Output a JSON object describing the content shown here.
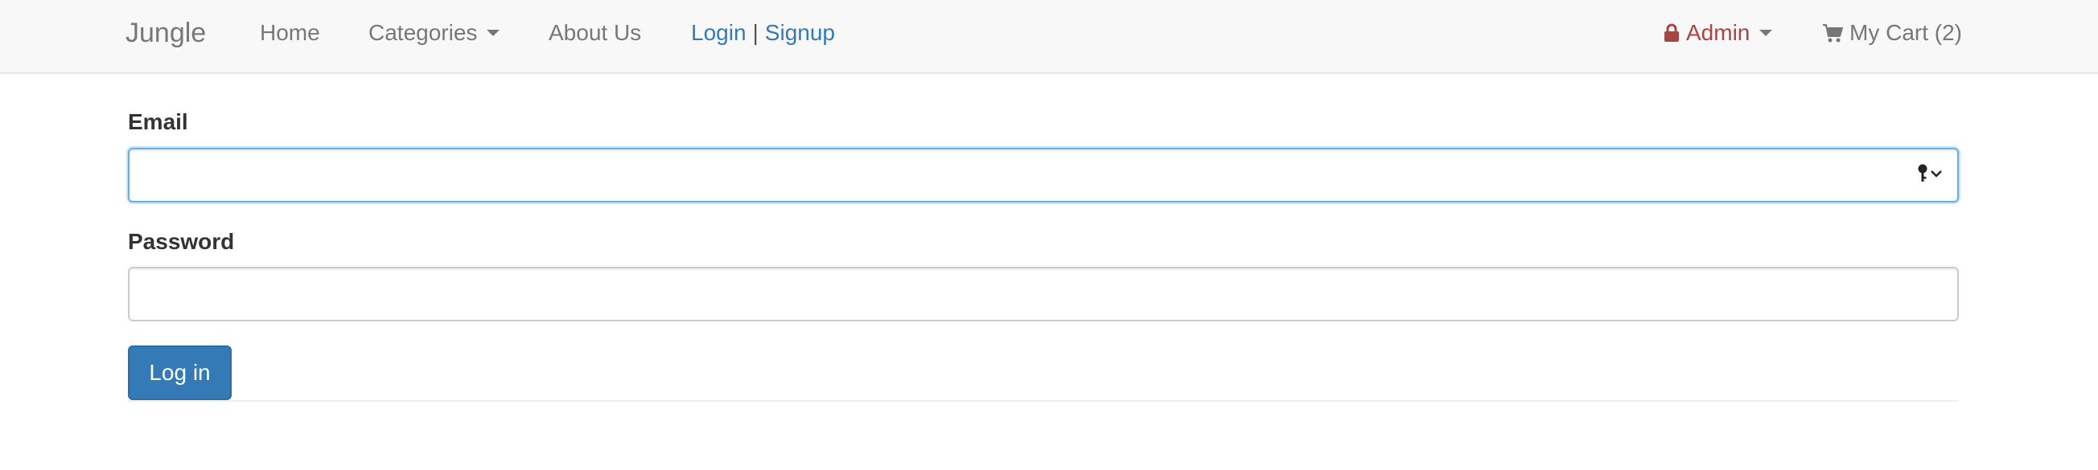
{
  "navbar": {
    "brand": "Jungle",
    "home": "Home",
    "categories": "Categories",
    "about": "About Us",
    "login": "Login",
    "separator": "|",
    "signup": "Signup",
    "admin": "Admin",
    "cart": "My Cart (2)"
  },
  "form": {
    "email_label": "Email",
    "email_value": "",
    "password_label": "Password",
    "password_value": "",
    "submit_label": "Log in"
  },
  "icons": {
    "admin": "lock-icon",
    "cart": "shopping-cart-icon",
    "email_autofill": "key-icon"
  },
  "colors": {
    "link": "#337ab7",
    "admin": "#a94442",
    "button": "#337ab7",
    "focus_border": "#66afe9"
  }
}
